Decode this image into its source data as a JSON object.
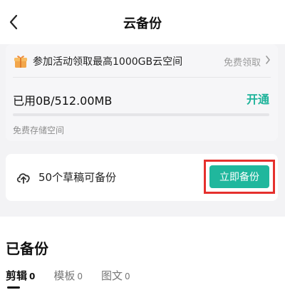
{
  "header": {
    "title": "云备份"
  },
  "promo": {
    "text": "参加活动领取最高1000GB云空间",
    "action": "免费领取"
  },
  "storage": {
    "used_label": "已用0B/512.00MB",
    "open_label": "开通",
    "used_fraction": 0.0,
    "free_label": "免费存储空间"
  },
  "drafts": {
    "text": "50个草稿可备份",
    "button": "立即备份"
  },
  "backed": {
    "title": "已备份",
    "tabs": [
      {
        "label": "剪辑",
        "count": "0",
        "active": true
      },
      {
        "label": "模板",
        "count": "0"
      },
      {
        "label": "图文",
        "count": "0"
      }
    ]
  },
  "colors": {
    "accent": "#1db39a",
    "highlight": "#e5302d"
  },
  "icons": {
    "back": "back-arrow-icon",
    "gift": "gift-icon",
    "chevron": "chevron-right-icon",
    "cloud": "cloud-upload-icon"
  }
}
